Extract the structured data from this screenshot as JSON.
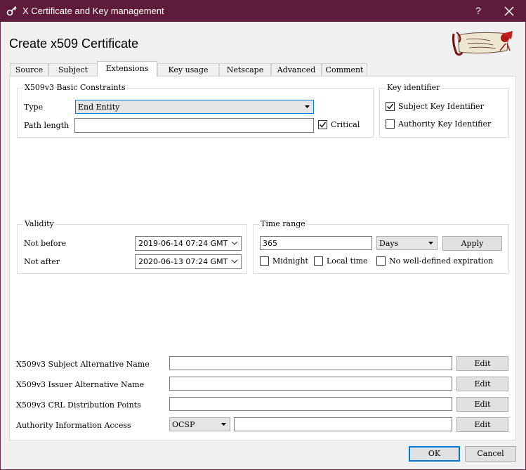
{
  "window": {
    "title": "X Certificate and Key management",
    "help_label": "?"
  },
  "heading": "Create x509 Certificate",
  "tabs": [
    "Source",
    "Subject",
    "Extensions",
    "Key usage",
    "Netscape",
    "Advanced",
    "Comment"
  ],
  "active_tab": "Extensions",
  "basic_constraints": {
    "legend": "X509v3 Basic Constraints",
    "type_label": "Type",
    "type_value": "End Entity",
    "path_length_label": "Path length",
    "path_length_value": "",
    "critical_label": "Critical",
    "critical_checked": true
  },
  "key_identifier": {
    "legend": "Key identifier",
    "subject_label": "Subject Key Identifier",
    "subject_checked": true,
    "authority_label": "Authority Key Identifier",
    "authority_checked": false
  },
  "validity": {
    "legend": "Validity",
    "not_before_label": "Not before",
    "not_before_value": "2019-06-14 07:24 GMT",
    "not_after_label": "Not after",
    "not_after_value": "2020-06-13 07:24 GMT"
  },
  "time_range": {
    "legend": "Time range",
    "value": "365",
    "unit": "Days",
    "apply_label": "Apply",
    "midnight_label": "Midnight",
    "local_time_label": "Local time",
    "no_expiration_label": "No well-defined expiration"
  },
  "extensions": {
    "san_label": "X509v3 Subject Alternative Name",
    "ian_label": "X509v3 Issuer Alternative Name",
    "crl_label": "X509v3 CRL Distribution Points",
    "aia_label": "Authority Information Access",
    "aia_method": "OCSP",
    "edit_label": "Edit"
  },
  "footer": {
    "ok_label": "OK",
    "cancel_label": "Cancel"
  },
  "colors": {
    "titlebar": "#5e1c3a",
    "focus": "#0078d7"
  }
}
